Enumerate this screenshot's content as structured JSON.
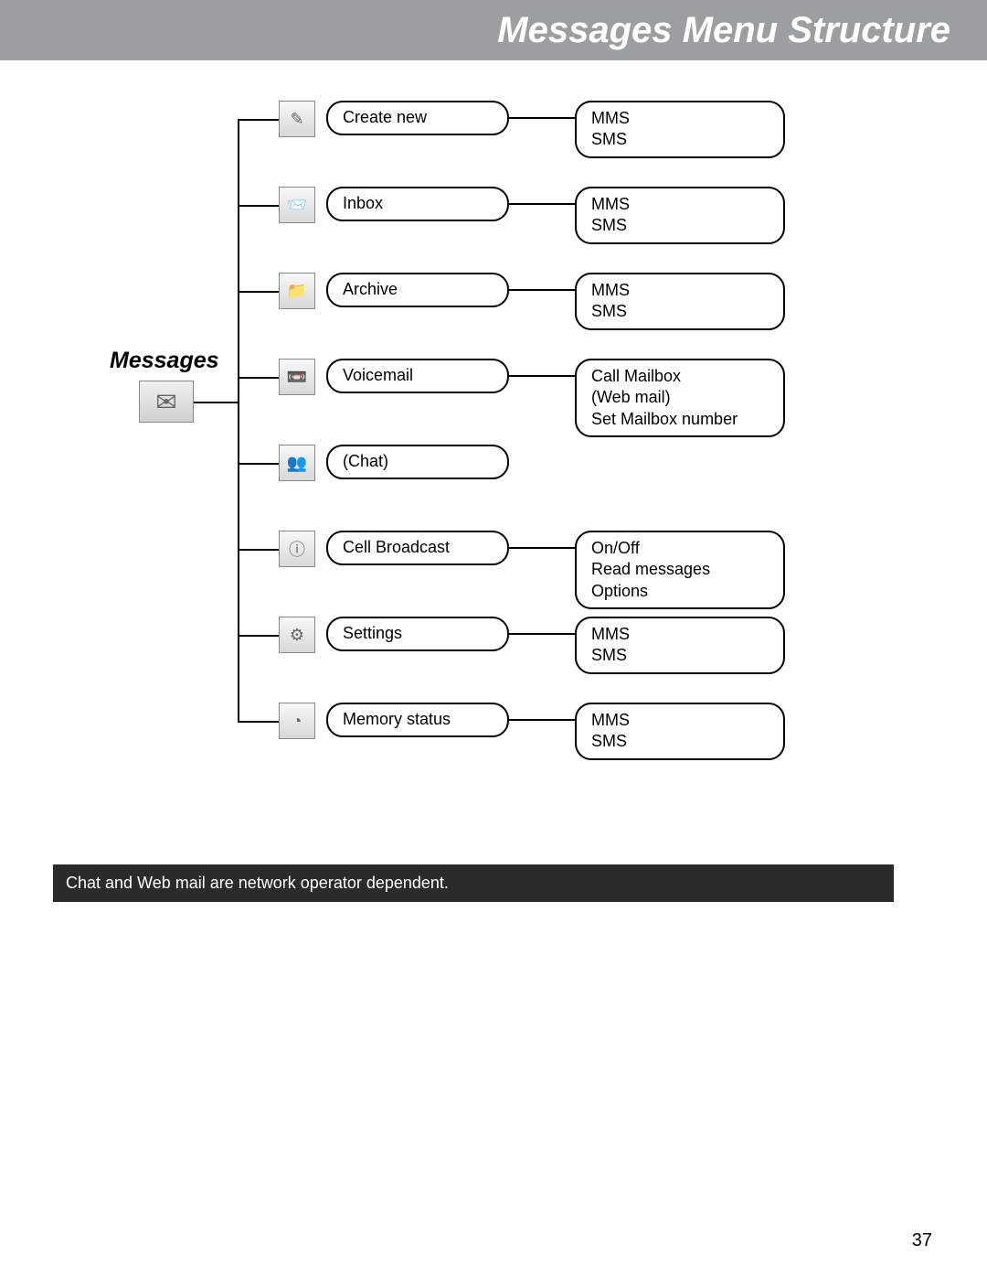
{
  "header": {
    "title": "Messages Menu Structure"
  },
  "root": {
    "label": "Messages"
  },
  "items": [
    {
      "label": "Create new",
      "sub": "MMS\nSMS"
    },
    {
      "label": "Inbox",
      "sub": "MMS\nSMS"
    },
    {
      "label": "Archive",
      "sub": "MMS\nSMS"
    },
    {
      "label": "Voicemail",
      "sub": "Call Mailbox\n(Web mail)\nSet Mailbox number"
    },
    {
      "label": "(Chat)",
      "sub": null
    },
    {
      "label": "Cell Broadcast",
      "sub": "On/Off\nRead messages\nOptions"
    },
    {
      "label": "Settings",
      "sub": "MMS\nSMS"
    },
    {
      "label": "Memory status",
      "sub": "MMS\nSMS"
    }
  ],
  "icons": [
    "✎",
    "📨",
    "📁",
    "📼",
    "👥",
    "ⓘ",
    "⚙",
    "◔"
  ],
  "note": "Chat and Web mail are network operator dependent.",
  "page": "37"
}
